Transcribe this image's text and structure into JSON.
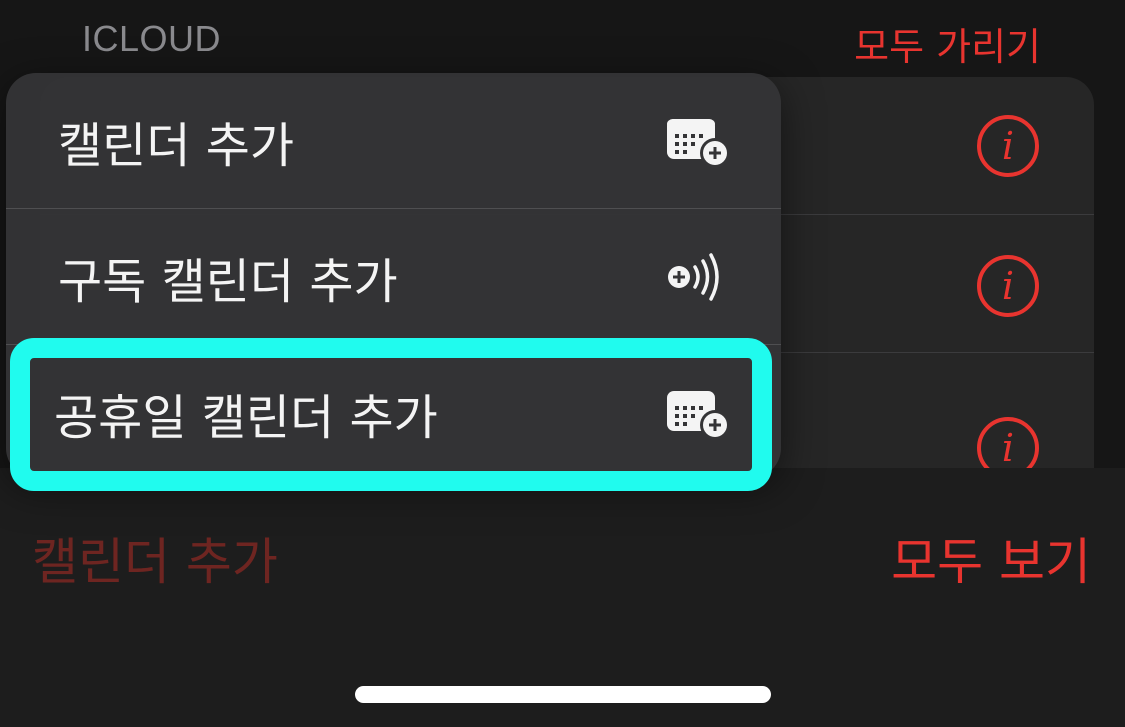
{
  "header": {
    "section_title": "ICLOUD",
    "hide_all_label": "모두 가리기"
  },
  "calendar_list": {
    "rows": [
      {
        "info_icon": "info-icon"
      },
      {
        "info_icon": "info-icon"
      },
      {
        "info_icon": "info-icon"
      }
    ]
  },
  "menu": {
    "items": [
      {
        "label": "캘린더 추가",
        "icon": "calendar-add-icon"
      },
      {
        "label": "구독 캘린더 추가",
        "icon": "subscribe-broadcast-icon"
      },
      {
        "label": "공휴일 캘린더 추가",
        "icon": "calendar-add-icon"
      }
    ]
  },
  "bottom_bar": {
    "add_calendar_label": "캘린더 추가",
    "show_all_label": "모두 보기"
  },
  "colors": {
    "accent": "#e8342f",
    "highlight": "#20fbee",
    "menu_bg": "#343436",
    "background": "#161616"
  }
}
